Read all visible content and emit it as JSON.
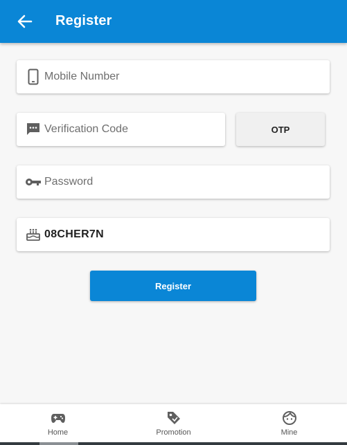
{
  "header": {
    "title": "Register",
    "back_icon": "arrow-left-icon",
    "background": "#0a86d6"
  },
  "form": {
    "mobile": {
      "placeholder": "Mobile Number",
      "value": "",
      "icon": "smartphone-icon"
    },
    "verification": {
      "placeholder": "Verification Code",
      "value": "",
      "icon": "sms-icon"
    },
    "otp_button": {
      "label": "OTP"
    },
    "password": {
      "placeholder": "Password",
      "value": "",
      "icon": "key-icon"
    },
    "invite": {
      "placeholder": "",
      "value": "08CHER7N",
      "icon": "cake-icon"
    },
    "register_button": {
      "label": "Register"
    }
  },
  "bottom_nav": {
    "items": [
      {
        "label": "Home",
        "icon": "gamepad-icon"
      },
      {
        "label": "Promotion",
        "icon": "tag-icon"
      },
      {
        "label": "Mine",
        "icon": "face-icon"
      }
    ]
  },
  "colors": {
    "accent": "#0a86d6",
    "background": "#f7f7f7",
    "icon_gray": "#5f5f5f"
  }
}
